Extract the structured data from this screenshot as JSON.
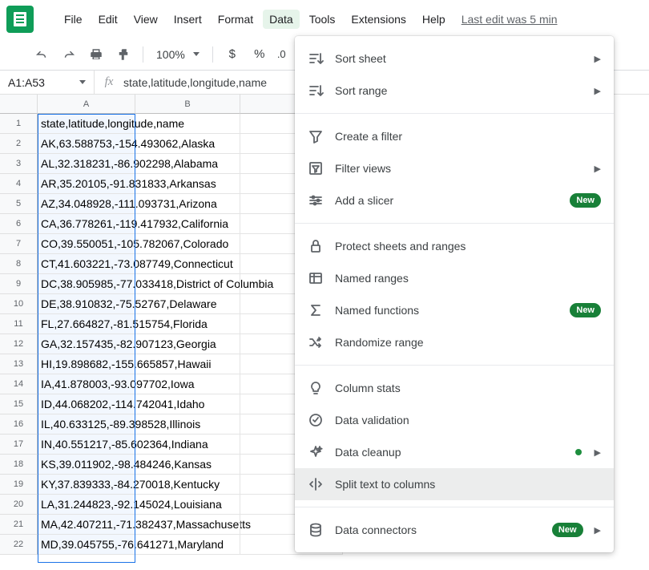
{
  "menu": {
    "items": [
      "File",
      "Edit",
      "View",
      "Insert",
      "Format",
      "Data",
      "Tools",
      "Extensions",
      "Help"
    ],
    "active": "Data",
    "last_edit": "Last edit was 5 min"
  },
  "toolbar": {
    "zoom": "100%",
    "currency": "$",
    "percent": "%",
    "decimal": ".0"
  },
  "formula_bar": {
    "name_box": "A1:A53",
    "fx": "fx",
    "value": "state,latitude,longitude,name"
  },
  "columns": [
    "A",
    "B"
  ],
  "rows": [
    {
      "n": 1,
      "a": "state,latitude,longitude,name"
    },
    {
      "n": 2,
      "a": "AK,63.588753,-154.493062,Alaska"
    },
    {
      "n": 3,
      "a": "AL,32.318231,-86.902298,Alabama"
    },
    {
      "n": 4,
      "a": "AR,35.20105,-91.831833,Arkansas"
    },
    {
      "n": 5,
      "a": "AZ,34.048928,-111.093731,Arizona"
    },
    {
      "n": 6,
      "a": "CA,36.778261,-119.417932,California"
    },
    {
      "n": 7,
      "a": "CO,39.550051,-105.782067,Colorado"
    },
    {
      "n": 8,
      "a": "CT,41.603221,-73.087749,Connecticut"
    },
    {
      "n": 9,
      "a": "DC,38.905985,-77.033418,District of Columbia"
    },
    {
      "n": 10,
      "a": "DE,38.910832,-75.52767,Delaware"
    },
    {
      "n": 11,
      "a": "FL,27.664827,-81.515754,Florida"
    },
    {
      "n": 12,
      "a": "GA,32.157435,-82.907123,Georgia"
    },
    {
      "n": 13,
      "a": "HI,19.898682,-155.665857,Hawaii"
    },
    {
      "n": 14,
      "a": "IA,41.878003,-93.097702,Iowa"
    },
    {
      "n": 15,
      "a": "ID,44.068202,-114.742041,Idaho"
    },
    {
      "n": 16,
      "a": "IL,40.633125,-89.398528,Illinois"
    },
    {
      "n": 17,
      "a": "IN,40.551217,-85.602364,Indiana"
    },
    {
      "n": 18,
      "a": "KS,39.011902,-98.484246,Kansas"
    },
    {
      "n": 19,
      "a": "KY,37.839333,-84.270018,Kentucky"
    },
    {
      "n": 20,
      "a": "LA,31.244823,-92.145024,Louisiana"
    },
    {
      "n": 21,
      "a": "MA,42.407211,-71.382437,Massachusetts"
    },
    {
      "n": 22,
      "a": "MD,39.045755,-76.641271,Maryland"
    }
  ],
  "dropdown": {
    "groups": [
      [
        {
          "icon": "sort-sheet",
          "label": "Sort sheet",
          "sub": true
        },
        {
          "icon": "sort-range",
          "label": "Sort range",
          "sub": true
        }
      ],
      [
        {
          "icon": "filter",
          "label": "Create a filter"
        },
        {
          "icon": "filter-views",
          "label": "Filter views",
          "sub": true
        },
        {
          "icon": "slicer",
          "label": "Add a slicer",
          "badge": "New"
        }
      ],
      [
        {
          "icon": "lock",
          "label": "Protect sheets and ranges"
        },
        {
          "icon": "named-ranges",
          "label": "Named ranges"
        },
        {
          "icon": "sigma",
          "label": "Named functions",
          "badge": "New"
        },
        {
          "icon": "shuffle",
          "label": "Randomize range"
        }
      ],
      [
        {
          "icon": "bulb",
          "label": "Column stats"
        },
        {
          "icon": "check-circle",
          "label": "Data validation"
        },
        {
          "icon": "sparkle",
          "label": "Data cleanup",
          "dot": true,
          "sub": true
        },
        {
          "icon": "split",
          "label": "Split text to columns",
          "hover": true
        }
      ],
      [
        {
          "icon": "db",
          "label": "Data connectors",
          "badge": "New",
          "sub": true
        }
      ]
    ]
  }
}
